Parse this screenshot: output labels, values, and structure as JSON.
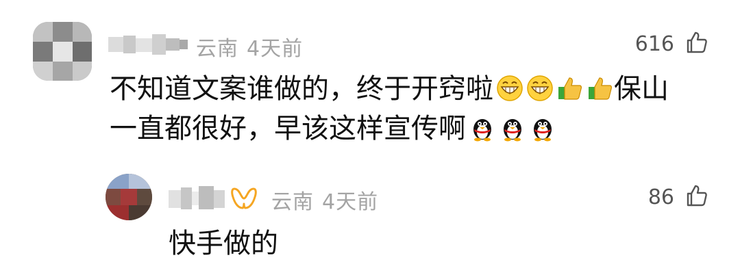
{
  "comments": [
    {
      "location": "云南",
      "time": "4天前",
      "likes": "616",
      "text_line1": "不知道文案谁做的，终于开窍啦",
      "line1_emojis": [
        "grin-emoji",
        "grin-emoji",
        "thumbs-up-emoji",
        "thumbs-up-emoji"
      ],
      "text_line1b": "保山",
      "text_line2": "一直都很好，早该这样宣传啊",
      "line2_emojis": [
        "penguin-emoji",
        "penguin-emoji",
        "penguin-emoji"
      ],
      "avatar_icon": "blurred-avatar",
      "name_icon": "blurred-username"
    },
    {
      "location": "云南",
      "time": "4天前",
      "likes": "86",
      "text": "快手做的",
      "badge_icon": "author-badge-icon",
      "avatar_icon": "blurred-avatar",
      "name_icon": "blurred-username"
    }
  ],
  "colors": {
    "meta_text": "#a4a4a4",
    "body_text": "#111111",
    "like_count": "#555555",
    "badge": "#f5a623"
  }
}
